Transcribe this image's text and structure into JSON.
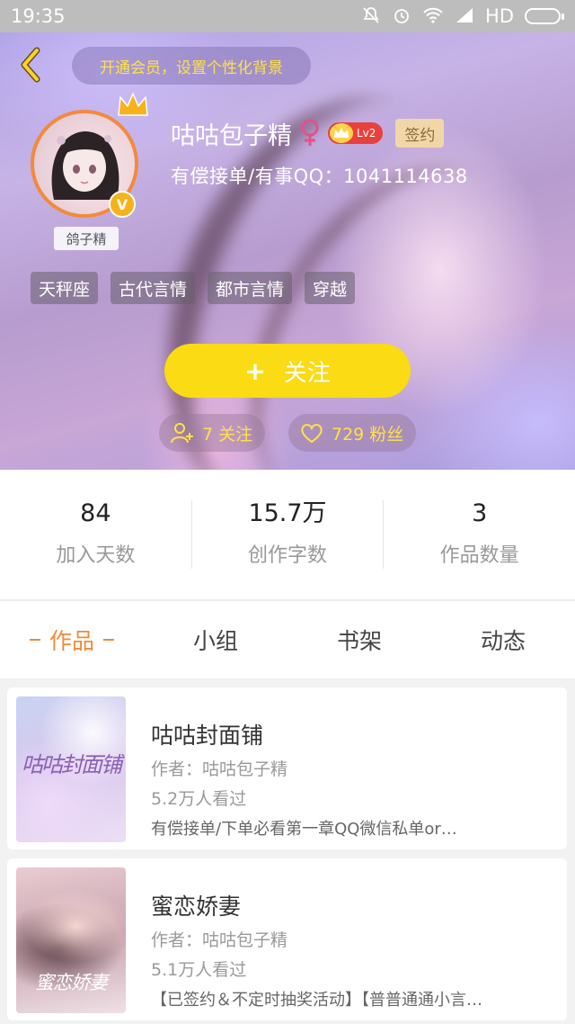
{
  "status_bar": {
    "time": "19:35",
    "network": "HD"
  },
  "header": {
    "vip_banner": "开通会员，设置个性化背景",
    "avatar_caption": "鸽子精",
    "v_badge": "V",
    "username": "咕咕包子精",
    "level": "Lv2",
    "signed_label": "签约",
    "bio": "有偿接单/有事QQ：1041114638",
    "tags": [
      "天秤座",
      "古代言情",
      "都市言情",
      "穿越"
    ],
    "follow_button": {
      "icon": "+",
      "label": "关注"
    },
    "following": "7 关注",
    "followers": "729 粉丝"
  },
  "stats": [
    {
      "value": "84",
      "label": "加入天数"
    },
    {
      "value": "15.7万",
      "label": "创作字数"
    },
    {
      "value": "3",
      "label": "作品数量"
    }
  ],
  "tabs": [
    {
      "label": "作品",
      "active": true
    },
    {
      "label": "小组",
      "active": false
    },
    {
      "label": "书架",
      "active": false
    },
    {
      "label": "动态",
      "active": false
    }
  ],
  "works": [
    {
      "title": "咕咕封面铺",
      "author": "作者：咕咕包子精",
      "views": "5.2万人看过",
      "description": "有偿接单/下单必看第一章QQ微信私单or…",
      "cover_text": "咕咕封面铺"
    },
    {
      "title": "蜜恋娇妻",
      "author": "作者：咕咕包子精",
      "views": "5.1万人看过",
      "description": "【已签约＆不定时抽奖活动】【普普通通小言…",
      "cover_text": "蜜恋娇妻"
    }
  ],
  "colors": {
    "accent_yellow": "#fadb14",
    "banner_text": "#ffe14a",
    "tab_active": "#f08a3a",
    "avatar_border": "#f28a3c",
    "level_badge": "#e8413c",
    "female_symbol": "#e6508a"
  }
}
